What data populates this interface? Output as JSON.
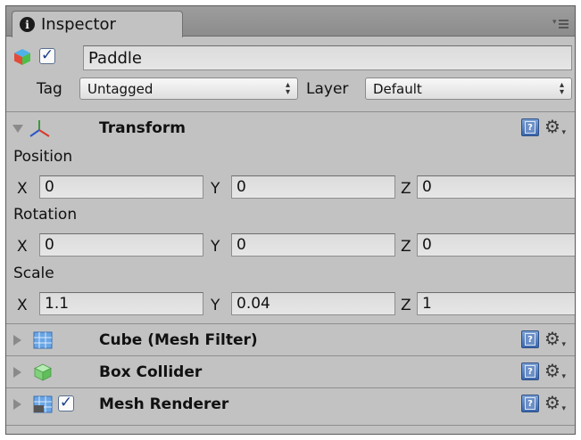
{
  "inspector": {
    "tab_label": "Inspector",
    "info_glyph": "i",
    "menu_icon": "tab-menu-icon"
  },
  "object": {
    "name": "Paddle",
    "active": true,
    "tag_label": "Tag",
    "tag_value": "Untagged",
    "layer_label": "Layer",
    "layer_value": "Default"
  },
  "transform": {
    "title": "Transform",
    "expanded": true,
    "position": {
      "label": "Position",
      "x": "0",
      "y": "0",
      "z": "0"
    },
    "rotation": {
      "label": "Rotation",
      "x": "0",
      "y": "0",
      "z": "0"
    },
    "scale": {
      "label": "Scale",
      "x": "1.1",
      "y": "0.04",
      "z": "1"
    },
    "axis_x": "X",
    "axis_y": "Y",
    "axis_z": "Z"
  },
  "components": [
    {
      "title": "Cube (Mesh Filter)",
      "icon": "mesh-filter-icon",
      "has_checkbox": false
    },
    {
      "title": "Box Collider",
      "icon": "box-collider-icon",
      "has_checkbox": false
    },
    {
      "title": "Mesh Renderer",
      "icon": "mesh-renderer-icon",
      "has_checkbox": true,
      "enabled": true
    }
  ],
  "colors": {
    "panel_bg": "#c2c2c2",
    "tab_bar": "#8c8c8c",
    "field_bg": "#e0e0e0",
    "check_blue": "#1d3f8c",
    "help_blue": "#3b67ad"
  }
}
